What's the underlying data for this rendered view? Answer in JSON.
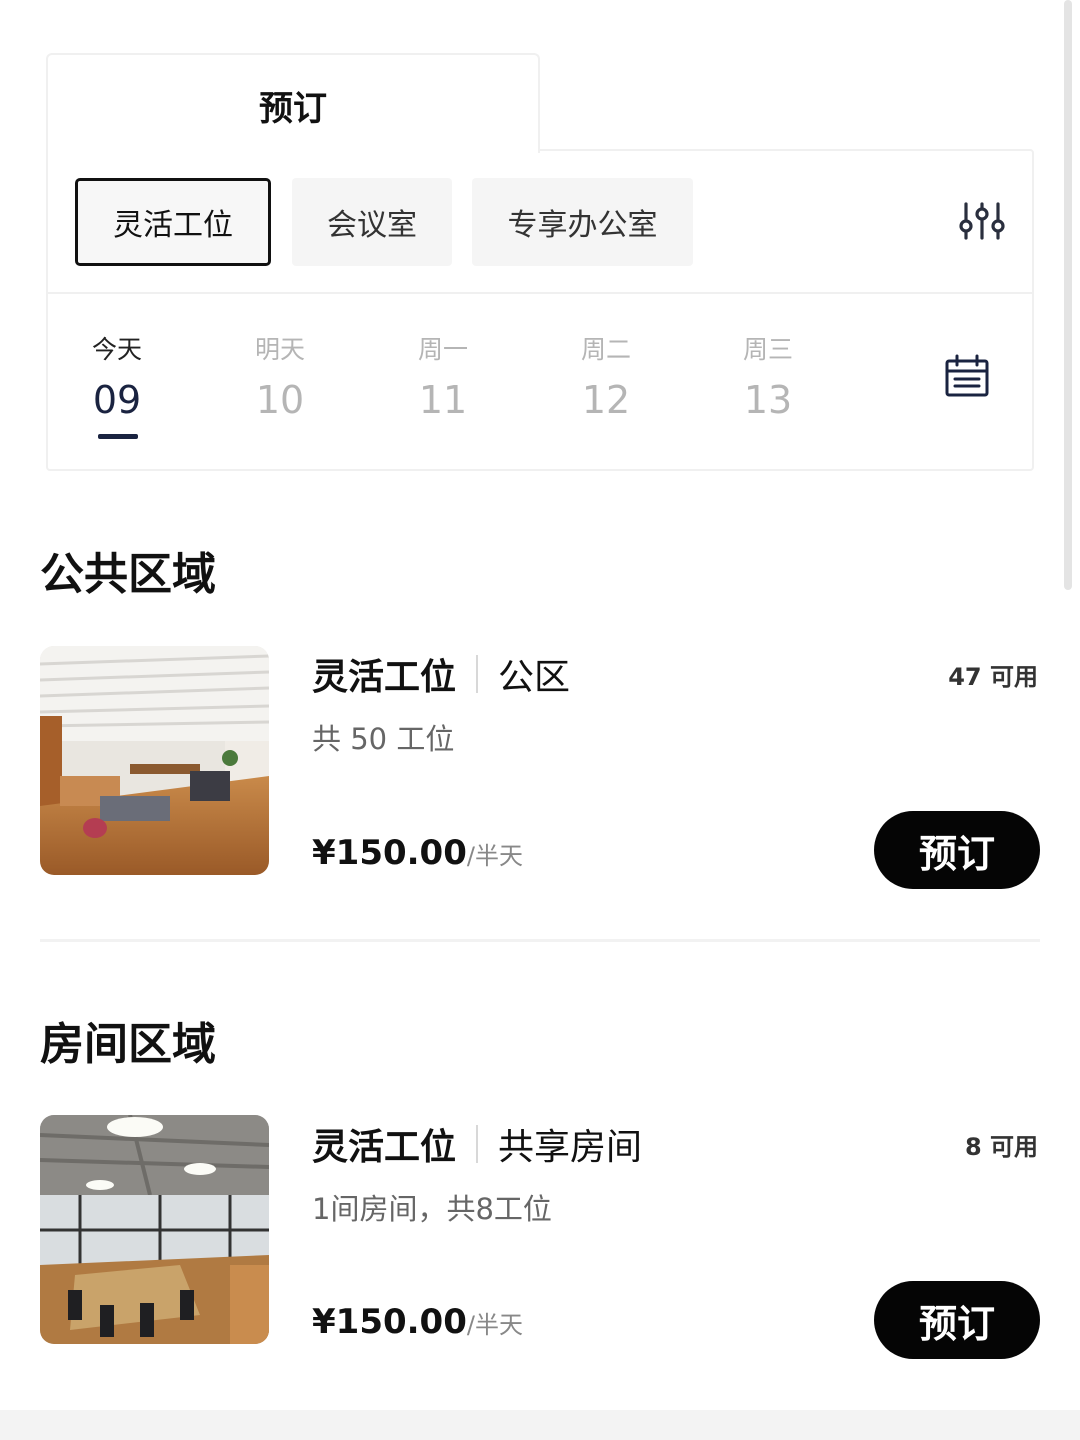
{
  "tab": {
    "label": "预订"
  },
  "types": [
    {
      "label": "灵活工位",
      "active": true
    },
    {
      "label": "会议室",
      "active": false
    },
    {
      "label": "专享办公室",
      "active": false
    }
  ],
  "icons": {
    "filter": "sliders-icon",
    "calendar": "calendar-icon"
  },
  "days": [
    {
      "weekday": "今天",
      "date": "09",
      "active": true
    },
    {
      "weekday": "明天",
      "date": "10",
      "active": false
    },
    {
      "weekday": "周一",
      "date": "11",
      "active": false
    },
    {
      "weekday": "周二",
      "date": "12",
      "active": false
    },
    {
      "weekday": "周三",
      "date": "13",
      "active": false
    }
  ],
  "sections": [
    {
      "title": "公共区域",
      "item": {
        "name": "灵活工位",
        "area": "公区",
        "available": "47 可用",
        "description": "共 50 工位",
        "price": "¥150.00",
        "unit": "/半天",
        "button": "预订"
      }
    },
    {
      "title": "房间区域",
      "item": {
        "name": "灵活工位",
        "area": "共享房间",
        "available": "8 可用",
        "description": "1间房间，共8工位",
        "price": "¥150.00",
        "unit": "/半天",
        "button": "预订"
      }
    }
  ],
  "colors": {
    "accent": "#1a2340",
    "button": "#050505",
    "muted": "#b5b5b5"
  }
}
